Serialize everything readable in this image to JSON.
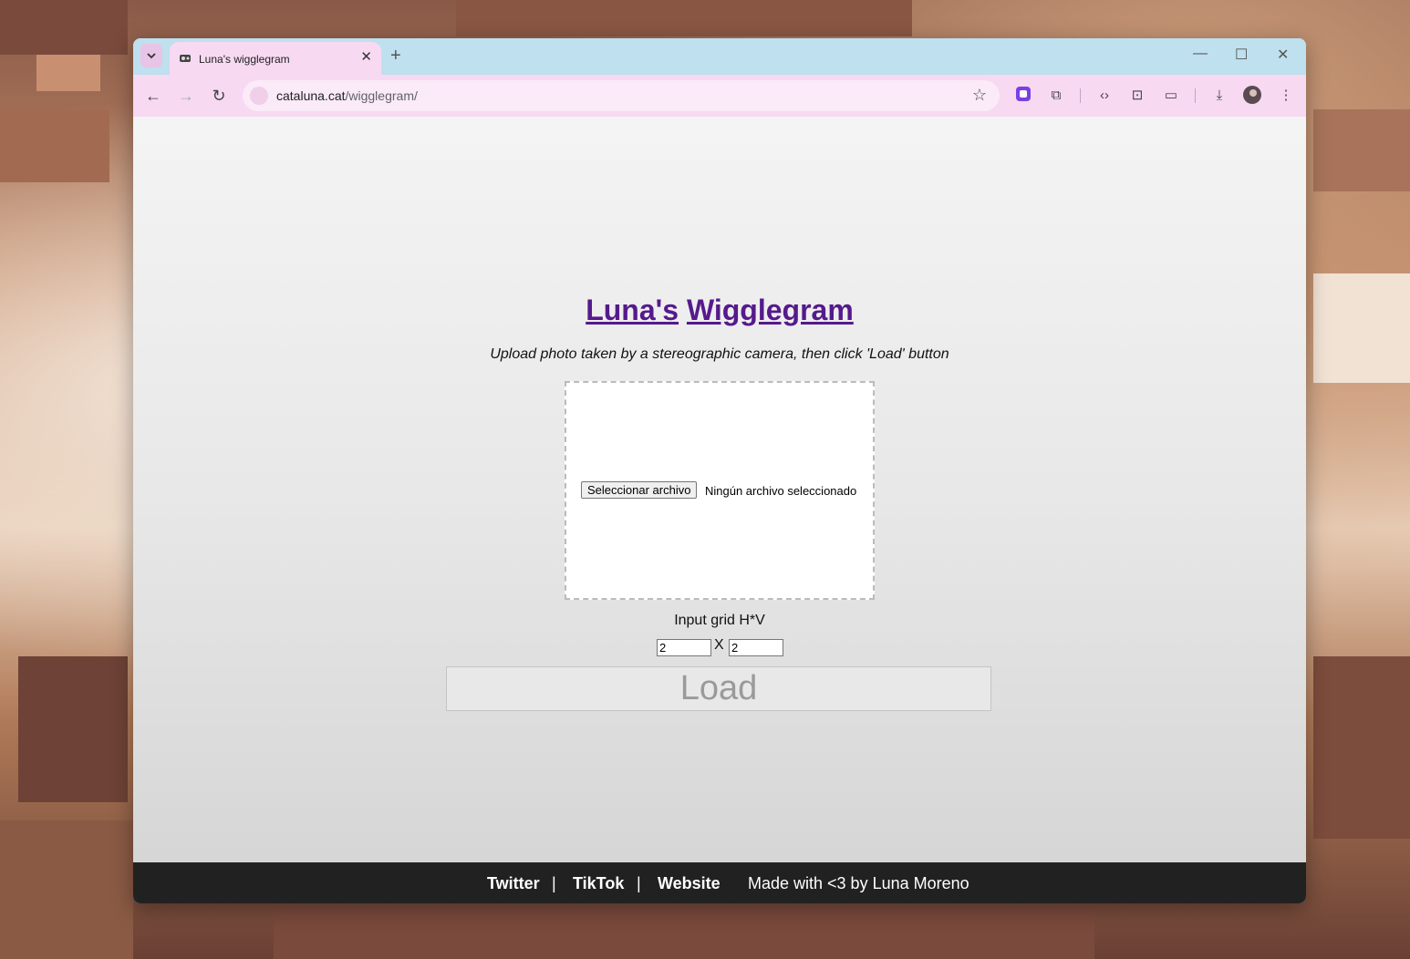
{
  "browser": {
    "tab_title": "Luna's wigglegram",
    "new_tab": "+",
    "close_tab": "✕",
    "url_host": "cataluna.cat",
    "url_path": "/wigglegram/",
    "window_controls": {
      "minimize": "—",
      "maximize": "☐",
      "close": "✕"
    },
    "icons": [
      "chevron-down-icon",
      "favicon",
      "back-arrow-icon",
      "forward-arrow-icon",
      "reload-icon",
      "site-settings-icon",
      "star-icon",
      "extension-icon",
      "puzzle-icon",
      "code-icon",
      "screenshot-icon",
      "devices-icon",
      "download-icon",
      "avatar",
      "menu-dots-icon"
    ]
  },
  "page": {
    "title_part1": "Luna's",
    "title_part2": "Wigglegram",
    "subtitle": "Upload photo taken by a stereographic camera, then click 'Load' button",
    "file_button": "Seleccionar archivo",
    "file_status": "Ningún archivo seleccionado",
    "grid_label": "Input grid H*V",
    "grid_h": "2",
    "grid_sep": "X",
    "grid_v": "2",
    "load_button": "Load"
  },
  "footer": {
    "twitter": "Twitter",
    "sep1": "|",
    "tiktok": "TikTok",
    "sep2": "|",
    "website": "Website",
    "credit": "Made with <3 by Luna Moreno"
  },
  "colors": {
    "tabbar": "#bfe0ee",
    "toolbar": "#f7d9f2",
    "link": "#551a8b",
    "footer_bg": "#212121"
  }
}
